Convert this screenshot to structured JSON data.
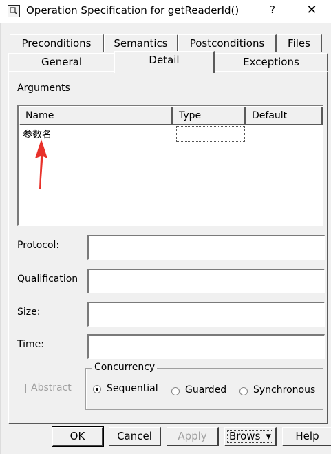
{
  "window": {
    "title": "Operation Specification for getReaderId()",
    "help_glyph": "?",
    "close_glyph": "✕",
    "app_icon": "rose-model-icon"
  },
  "tabs": {
    "row1": [
      "Preconditions",
      "Semantics",
      "Postconditions",
      "Files"
    ],
    "row2": [
      "General",
      "Detail",
      "Exceptions"
    ],
    "active": "Detail"
  },
  "arguments": {
    "label": "Arguments",
    "columns": [
      "Name",
      "Type",
      "Default"
    ],
    "rows": [
      {
        "name": "参数名",
        "type": "",
        "default": ""
      }
    ]
  },
  "fields": {
    "protocol": {
      "label": "Protocol:",
      "value": ""
    },
    "qualification": {
      "label": "Qualification",
      "value": ""
    },
    "size": {
      "label": "Size:",
      "value": ""
    },
    "time": {
      "label": "Time:",
      "value": ""
    }
  },
  "abstract": {
    "label": "Abstract",
    "checked": false,
    "enabled": false
  },
  "concurrency": {
    "label": "Concurrency",
    "options": [
      "Sequential",
      "Guarded",
      "Synchronous"
    ],
    "selected": "Sequential"
  },
  "buttons": {
    "ok": "OK",
    "cancel": "Cancel",
    "apply": "Apply",
    "browse": "Brows",
    "browse_arrow": "▾",
    "help": "Help"
  },
  "annotation": {
    "arrow_color": "#e8312a"
  }
}
